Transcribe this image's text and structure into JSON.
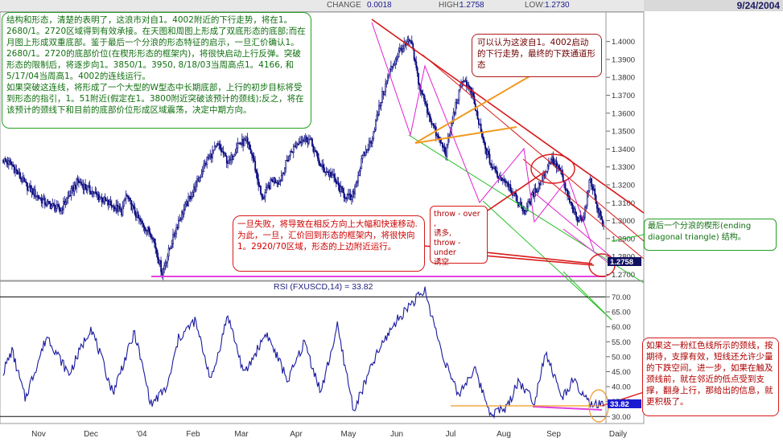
{
  "header": {
    "change_label": "CHANGE",
    "change_value": "0.0018",
    "high_label": "HIGH:",
    "high_value": "1.2758",
    "low_label": "LOW:",
    "low_value": "1.2730",
    "date": "9/24/2004"
  },
  "annotations": {
    "green_note_p1": "结构和形态，清楚的表明了，这浪市对自1。4002附近的下行走势，将在1。2680/1。2720区域得到有效承接。在天图和周图上形成了双底形态的底部;而在月图上形成双重底部。鉴于最后一个分浪的形态特征的启示，一旦汇价确认1。2680/1。2720的底部价位(在楔形形态的框架内)，将很快启动上行反弹。突破形态的限制后，将逐步向1。3850/1。3950, 8/18/03当周高点1。4166, 和5/17/04当周高1。4002的连线运行。",
    "green_note_p2": "如果突破这连线，将形成了一个大型的W型态中长期底部，上行的初步目标将受到形态的指引，1。51附近(假定在1。3800附近突破该预计的颈线);反之，将在该预计的颈线下和目前的底部价位形成区域震荡，决定中期方向。",
    "red_note_top": "可以认为这波自1。4002启动的下行走势，最终的下跌通道形态",
    "red_note_mid_p1": "一旦失败，将导致在相反方向上大幅和快速移动.",
    "red_note_mid_p2": "为此，一旦，汇价回到形态的框架内，将很快向1。2920/70区域，形态的上边附近运行。",
    "throw_l1": "throw - over ,",
    "throw_l2": "诱多,",
    "throw_l3": "throw - under",
    "throw_l4": "诱空",
    "wedge_note": "最后一个分浪的楔形(ending diagonal triangle) 结构。",
    "neck_note": "如果这一粉红色线所示的颈线，按期待，支撑有效，短线还允许少量的下跌空间。进一步，如果在触及颈线前，就在邻近的低点受到支撑，翻身上行，那给出的信息，就更积极了。"
  },
  "rsi": {
    "title": "RSI (FXUSCD,14) = 33.82",
    "value_badge": "33.82"
  },
  "colors": {
    "candle": "#0a0a80",
    "rsi_line": "#1a1aa0",
    "channel_red": "#d81818",
    "channel_green": "#20c020",
    "wedge_magenta": "#e020d0",
    "neckline_pink": "#e040e0",
    "orange_arrow": "#f09a20",
    "price_badge": "#101060"
  },
  "chart_data": [
    {
      "type": "candlestick",
      "title": "",
      "yticks": [
        1.27,
        1.28,
        1.29,
        1.3,
        1.31,
        1.32,
        1.33,
        1.34,
        1.35,
        1.36,
        1.37,
        1.38,
        1.39,
        1.4
      ],
      "ytick_labels": [
        "1.2700",
        "1.2800",
        "1.2900",
        "1.3000",
        "1.3100",
        "1.3200",
        "1.3300",
        "1.3400",
        "1.3500",
        "1.3600",
        "1.3700",
        "1.3800",
        "1.3900",
        "1.4000"
      ],
      "ylim": [
        1.2675,
        1.416
      ],
      "x_labels": [
        "Nov",
        "Dec",
        "'04",
        "Feb",
        "Mar",
        "Apr",
        "May",
        "Jun",
        "Jul",
        "Aug",
        "Sep",
        "Daily"
      ],
      "last_price": "1.2758",
      "anchors_t": [
        0,
        8,
        20,
        38,
        52,
        68,
        90,
        108,
        112,
        124,
        136,
        145,
        160,
        176,
        186,
        196,
        206,
        214,
        222,
        228,
        236,
        246,
        252,
        262,
        272,
        280,
        290,
        300,
        310,
        318,
        328,
        336,
        346,
        354,
        362,
        372,
        380,
        388,
        396,
        404,
        412,
        420,
        428,
        438,
        446,
        452,
        460,
        468,
        476,
        484,
        492,
        500,
        508,
        516,
        524,
        530,
        536,
        542,
        548
      ],
      "anchors_price": [
        1.334,
        1.331,
        1.32,
        1.31,
        1.306,
        1.322,
        1.312,
        1.305,
        1.314,
        1.3,
        1.292,
        1.271,
        1.3,
        1.32,
        1.334,
        1.342,
        1.332,
        1.343,
        1.344,
        1.335,
        1.312,
        1.323,
        1.322,
        1.338,
        1.346,
        1.345,
        1.33,
        1.325,
        1.315,
        1.312,
        1.335,
        1.345,
        1.37,
        1.385,
        1.395,
        1.4002,
        1.375,
        1.36,
        1.347,
        1.338,
        1.362,
        1.38,
        1.37,
        1.344,
        1.33,
        1.325,
        1.322,
        1.312,
        1.305,
        1.315,
        1.323,
        1.335,
        1.328,
        1.312,
        1.3,
        1.303,
        1.324,
        1.308,
        1.297
      ]
    },
    {
      "type": "line",
      "title": "RSI (FXUSCD,14) = 33.82",
      "yticks": [
        30,
        35,
        40,
        45,
        50,
        55,
        60,
        65,
        70
      ],
      "ytick_labels": [
        "30.00",
        "35.00",
        "40.00",
        "45.00",
        "50.00",
        "55.00",
        "60.00",
        "65.00",
        "70.00"
      ],
      "ylim": [
        29,
        72
      ],
      "anchors_t": [
        0,
        8,
        20,
        40,
        60,
        80,
        100,
        120,
        135,
        150,
        160,
        175,
        190,
        205,
        220,
        240,
        260,
        275,
        290,
        305,
        320,
        340,
        355,
        370,
        385,
        400,
        415,
        430,
        445,
        460,
        470,
        485,
        495,
        510,
        520,
        535,
        548
      ],
      "anchors_value": [
        45,
        52,
        36,
        57,
        44,
        60,
        38,
        58,
        34,
        40,
        56,
        62,
        42,
        64,
        44,
        58,
        42,
        55,
        38,
        60,
        32,
        50,
        60,
        67,
        72,
        52,
        37,
        46,
        31,
        33,
        42,
        35,
        52,
        36,
        42,
        34,
        33.82
      ]
    }
  ]
}
